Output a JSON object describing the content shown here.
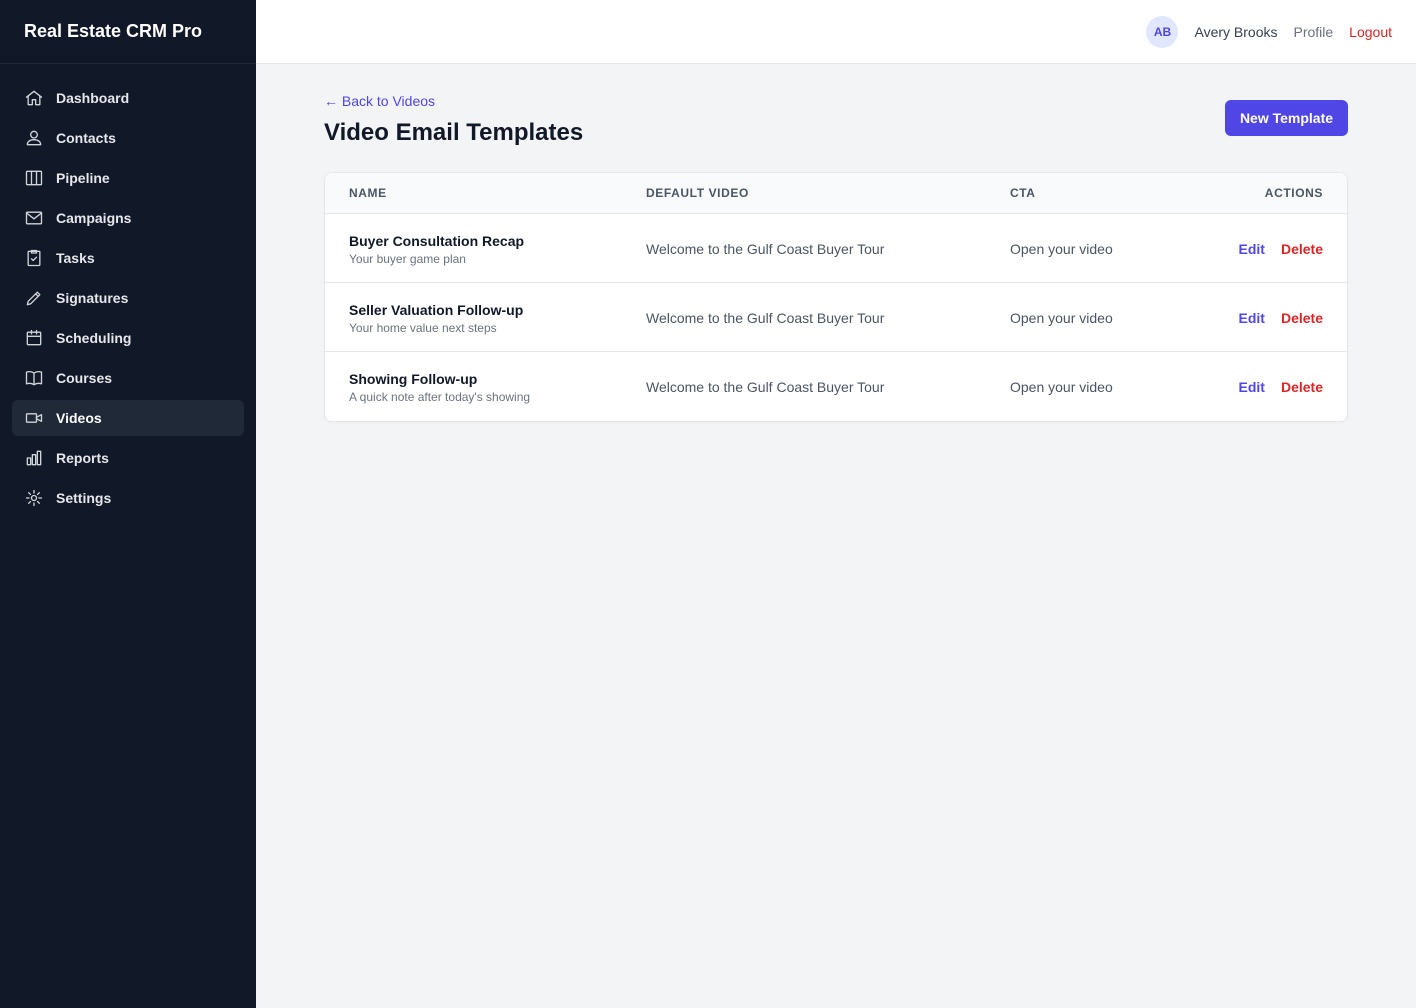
{
  "app": {
    "title": "Real Estate CRM Pro"
  },
  "sidebar": {
    "items": [
      {
        "label": "Dashboard",
        "icon": "home-icon",
        "active": false
      },
      {
        "label": "Contacts",
        "icon": "user-icon",
        "active": false
      },
      {
        "label": "Pipeline",
        "icon": "columns-icon",
        "active": false
      },
      {
        "label": "Campaigns",
        "icon": "mail-icon",
        "active": false
      },
      {
        "label": "Tasks",
        "icon": "clipboard-check-icon",
        "active": false
      },
      {
        "label": "Signatures",
        "icon": "pen-icon",
        "active": false
      },
      {
        "label": "Scheduling",
        "icon": "calendar-icon",
        "active": false
      },
      {
        "label": "Courses",
        "icon": "book-icon",
        "active": false
      },
      {
        "label": "Videos",
        "icon": "video-icon",
        "active": true
      },
      {
        "label": "Reports",
        "icon": "bar-chart-icon",
        "active": false
      },
      {
        "label": "Settings",
        "icon": "gear-icon",
        "active": false
      }
    ]
  },
  "header": {
    "avatar_initials": "AB",
    "user_name": "Avery Brooks",
    "profile_label": "Profile",
    "logout_label": "Logout"
  },
  "page": {
    "back_link": "← Back to Videos",
    "title": "Video Email Templates",
    "new_button": "New Template"
  },
  "table": {
    "columns": [
      "Name",
      "Default Video",
      "CTA",
      "Actions"
    ],
    "rows": [
      {
        "name": "Buyer Consultation Recap",
        "subtitle": "Your buyer game plan",
        "video": "Welcome to the Gulf Coast Buyer Tour",
        "cta": "Open your video",
        "edit": "Edit",
        "delete": "Delete"
      },
      {
        "name": "Seller Valuation Follow-up",
        "subtitle": "Your home value next steps",
        "video": "Welcome to the Gulf Coast Buyer Tour",
        "cta": "Open your video",
        "edit": "Edit",
        "delete": "Delete"
      },
      {
        "name": "Showing Follow-up",
        "subtitle": "A quick note after today's showing",
        "video": "Welcome to the Gulf Coast Buyer Tour",
        "cta": "Open your video",
        "edit": "Edit",
        "delete": "Delete"
      }
    ]
  },
  "colors": {
    "accent": "#4f46e5",
    "danger": "#dc2626",
    "sidebar_bg": "#111827"
  }
}
